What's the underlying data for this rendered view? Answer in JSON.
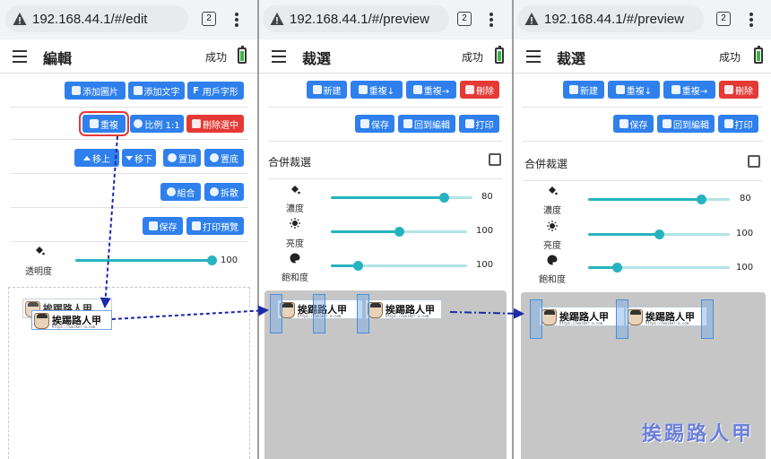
{
  "browser": {
    "screens": [
      {
        "url": "192.168.44.1/#/edit",
        "tab_count": "2"
      },
      {
        "url": "192.168.44.1/#/preview",
        "tab_count": "2"
      },
      {
        "url": "192.168.44.1/#/preview",
        "tab_count": "2"
      }
    ]
  },
  "edit_screen": {
    "title": "編輯",
    "status": "成功",
    "row1": {
      "add_image": "添加圖片",
      "add_text": "添加文字",
      "user_font": "用戶字形"
    },
    "row2": {
      "duplicate": "重複",
      "ratio": "比例 1:1",
      "delete_selected": "刪除選中"
    },
    "row3": {
      "move_up": "移上",
      "move_down": "移下",
      "to_top": "置頂",
      "to_bottom": "置底"
    },
    "row4": {
      "group": "組合",
      "ungroup": "拆散"
    },
    "row5": {
      "save": "保存",
      "print_preview": "打印預覽"
    },
    "opacity": {
      "label": "透明度",
      "value": "100",
      "fraction": 1.0
    }
  },
  "preview_screens": [
    {
      "title": "裁選",
      "status": "成功",
      "buttons": {
        "new": "新建",
        "dup_down": "重複↓",
        "dup_right": "重複→",
        "delete": "刪除",
        "save": "保存",
        "back_to_edit": "回到編輯",
        "print": "打印"
      },
      "merge_crop": "合併裁選",
      "sliders": [
        {
          "label": "濃度",
          "value": "80",
          "fraction": 0.8
        },
        {
          "label": "亮度",
          "value": "100",
          "fraction": 0.5
        },
        {
          "label": "飽和度",
          "value": "100",
          "fraction": 0.2
        }
      ]
    },
    {
      "title": "裁選",
      "status": "成功",
      "buttons": {
        "new": "新建",
        "dup_down": "重複↓",
        "dup_right": "重複→",
        "delete": "刪除",
        "save": "保存",
        "back_to_edit": "回到編輯",
        "print": "打印"
      },
      "merge_crop": "合併裁選",
      "sliders": [
        {
          "label": "濃度",
          "value": "80",
          "fraction": 0.8
        },
        {
          "label": "亮度",
          "value": "100",
          "fraction": 0.5
        },
        {
          "label": "飽和度",
          "value": "100",
          "fraction": 0.2
        }
      ]
    }
  ],
  "label_item": {
    "name": "挨踢路人甲",
    "url": "https://walker-a.com"
  },
  "watermark": "挨踢路人甲",
  "colors": {
    "primary": "#2f80ed",
    "danger": "#e53935",
    "slider": "#26b3bf",
    "battery": "#3bb54a"
  }
}
